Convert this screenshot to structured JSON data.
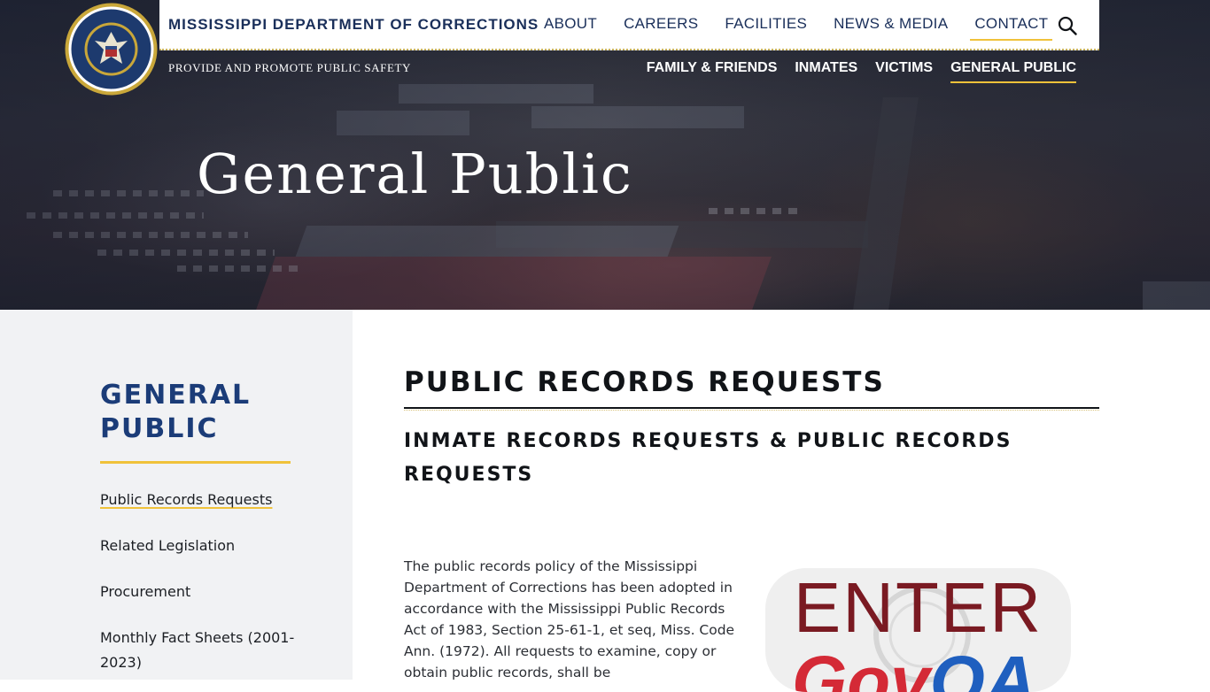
{
  "header": {
    "site_name": "MISSISSIPPI DEPARTMENT OF CORRECTIONS",
    "tagline": "PROVIDE AND PROMOTE PUBLIC SAFETY",
    "seal_text": "MISSISSIPPI DEPARTMENT OF CORRECTIONS",
    "nav_main": [
      {
        "label": "ABOUT"
      },
      {
        "label": "CAREERS"
      },
      {
        "label": "FACILITIES"
      },
      {
        "label": "NEWS & MEDIA"
      },
      {
        "label": "CONTACT"
      }
    ],
    "nav_sub": [
      {
        "label": "FAMILY & FRIENDS"
      },
      {
        "label": "INMATES"
      },
      {
        "label": "VICTIMS"
      },
      {
        "label": "GENERAL PUBLIC"
      }
    ],
    "search_icon": "search-icon"
  },
  "hero": {
    "title": "General Public"
  },
  "sidebar": {
    "title": "GENERAL PUBLIC",
    "links": [
      {
        "label": "Public Records Requests"
      },
      {
        "label": "Related Legislation"
      },
      {
        "label": "Procurement"
      },
      {
        "label": "Monthly Fact Sheets (2001-2023)"
      }
    ]
  },
  "main": {
    "title": "PUBLIC RECORDS REQUESTS",
    "subtitle": "INMATE RECORDS REQUESTS & PUBLIC RECORDS REQUESTS",
    "body": "The public records policy of the Mississippi Department of Corrections has been adopted in accordance with the Mississippi Public Records Act of 1983, Section 25-61-1, et seq, Miss. Code Ann. (1972).  All requests to examine, copy or obtain public records, shall be",
    "card": {
      "enter": "ENTER",
      "logo_gov": "Gov",
      "logo_qa": "QA"
    }
  },
  "colors": {
    "navy": "#1a2f5a",
    "accent_gold": "#f0c23a",
    "sidebar_title": "#1b3c78",
    "enter_red": "#7a1a22"
  }
}
